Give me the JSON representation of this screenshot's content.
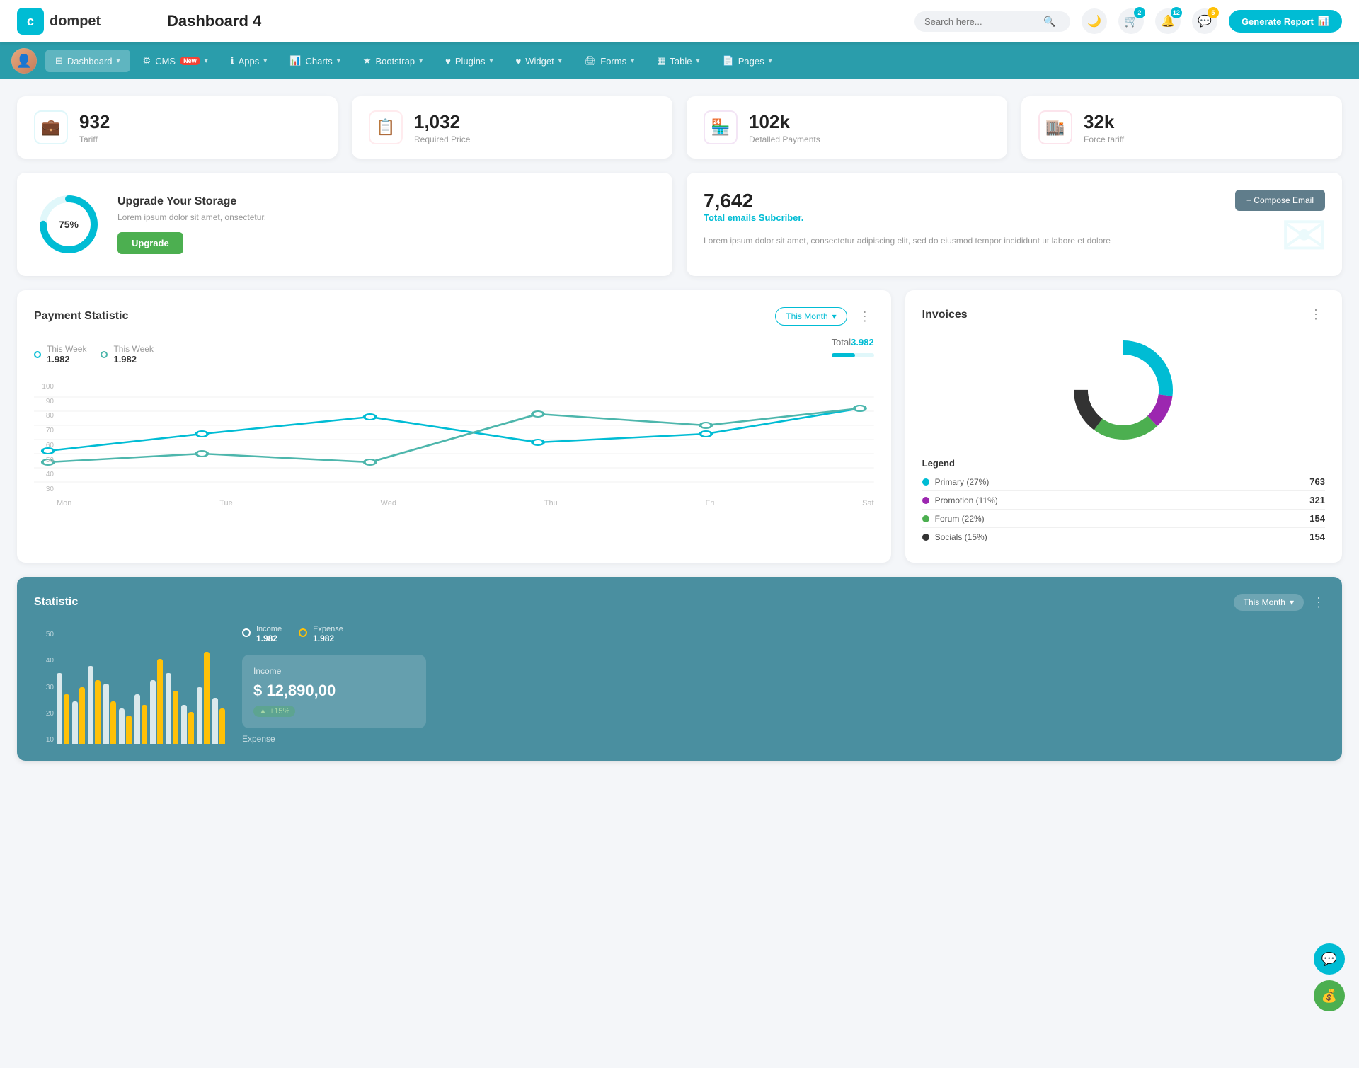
{
  "header": {
    "logo_letter": "c",
    "logo_brand": "dompet",
    "page_title": "Dashboard 4",
    "search_placeholder": "Search here...",
    "generate_btn": "Generate Report",
    "badges": {
      "cart": "2",
      "bell": "12",
      "chat": "5"
    }
  },
  "nav": {
    "items": [
      {
        "label": "Dashboard",
        "icon": "⊞",
        "has_arrow": true,
        "active": true
      },
      {
        "label": "CMS",
        "icon": "⚙",
        "has_arrow": true,
        "badge": "New"
      },
      {
        "label": "Apps",
        "icon": "ℹ",
        "has_arrow": true
      },
      {
        "label": "Charts",
        "icon": "📊",
        "has_arrow": true
      },
      {
        "label": "Bootstrap",
        "icon": "★",
        "has_arrow": true
      },
      {
        "label": "Plugins",
        "icon": "♥",
        "has_arrow": true
      },
      {
        "label": "Widget",
        "icon": "♥",
        "has_arrow": true
      },
      {
        "label": "Forms",
        "icon": "🖨",
        "has_arrow": true
      },
      {
        "label": "Table",
        "icon": "▦",
        "has_arrow": true
      },
      {
        "label": "Pages",
        "icon": "📄",
        "has_arrow": true
      }
    ]
  },
  "stat_cards": [
    {
      "value": "932",
      "label": "Tariff",
      "icon": "💼",
      "icon_class": "teal"
    },
    {
      "value": "1,032",
      "label": "Required Price",
      "icon": "📋",
      "icon_class": "red"
    },
    {
      "value": "102k",
      "label": "Detalled Payments",
      "icon": "🏪",
      "icon_class": "purple"
    },
    {
      "value": "32k",
      "label": "Force tariff",
      "icon": "🏬",
      "icon_class": "pink"
    }
  ],
  "upgrade": {
    "percent": "75%",
    "title": "Upgrade Your Storage",
    "description": "Lorem ipsum dolor sit amet, onsectetur.",
    "btn_label": "Upgrade",
    "donut_value": 75,
    "donut_color": "#00bcd4"
  },
  "email": {
    "count": "7,642",
    "subtitle": "Total emails Subcriber.",
    "description": "Lorem ipsum dolor sit amet, consectetur adipiscing elit, sed do eiusmod tempor incididunt ut labore et dolore",
    "compose_btn": "+ Compose Email"
  },
  "payment": {
    "title": "Payment Statistic",
    "filter_label": "This Month",
    "legend": [
      {
        "label": "This Week",
        "value": "1.982",
        "dot_class": "teal"
      },
      {
        "label": "This Week",
        "value": "1.982",
        "dot_class": "teal2"
      }
    ],
    "total_label": "Total",
    "total_value": "3.982",
    "progress_pct": 55,
    "x_labels": [
      "Mon",
      "Tue",
      "Wed",
      "Thu",
      "Fri",
      "Sat"
    ],
    "y_labels": [
      "100",
      "90",
      "80",
      "70",
      "60",
      "50",
      "40",
      "30"
    ],
    "line1_points": "10,85 105,55 200,40 295,75 390,65 485,30",
    "line2_points": "10,110 105,100 200,110 295,40 390,55 485,30"
  },
  "invoices": {
    "title": "Invoices",
    "legend_title": "Legend",
    "items": [
      {
        "label": "Primary (27%)",
        "value": "763",
        "color": "#00bcd4"
      },
      {
        "label": "Promotion (11%)",
        "value": "321",
        "color": "#9c27b0"
      },
      {
        "label": "Forum (22%)",
        "value": "154",
        "color": "#4caf50"
      },
      {
        "label": "Socials (15%)",
        "value": "154",
        "color": "#333"
      }
    ]
  },
  "statistic": {
    "title": "Statistic",
    "filter_label": "This Month",
    "y_labels": [
      "50",
      "40",
      "30",
      "20",
      "10"
    ],
    "legend": [
      {
        "label": "Income",
        "value": "1.982",
        "dot_class": "white-dot"
      },
      {
        "label": "Expense",
        "value": "1.982",
        "dot_class": "yellow-dot"
      }
    ],
    "income_box": {
      "title": "Income",
      "value": "$ 12,890,00",
      "badge": "+15%"
    },
    "expense_label": "Expense"
  }
}
